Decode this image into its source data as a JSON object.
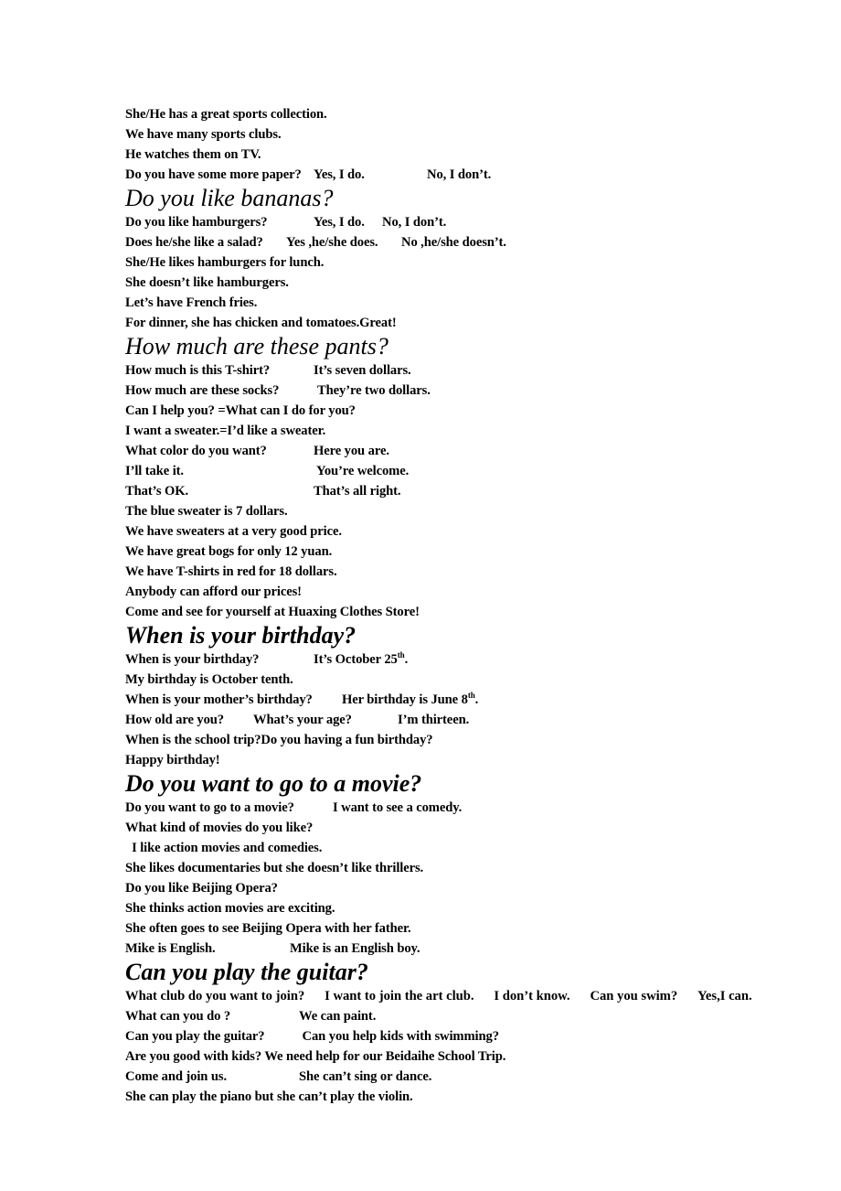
{
  "document": {
    "background_color": "#ffffff",
    "text_color": "#000000",
    "blocks": [
      {
        "type": "line",
        "text": "She/He has a great sports collection."
      },
      {
        "type": "line",
        "text": "We have many sports clubs."
      },
      {
        "type": "line",
        "text": "He watches them on TV."
      },
      {
        "type": "line",
        "text": "Do you have some more paper?",
        "col2": "Yes, I do.",
        "col3": "No, I don’t.",
        "col1_width": 206,
        "col2_width": 124
      },
      {
        "type": "heading",
        "text": "Do you like bananas?",
        "bold": false
      },
      {
        "type": "line",
        "text": "Do you like hamburgers?",
        "col2": "Yes, I do.",
        "col3": "No, I don’t.",
        "col1_width": 206,
        "col2_width": 75
      },
      {
        "type": "line",
        "text": "Does he/she like a salad?",
        "col2": "Yes ,he/she does.",
        "col3": "No ,he/she doesn’t.",
        "col1_width": 176,
        "col2_width": 126
      },
      {
        "type": "line",
        "text": "She/He likes hamburgers for lunch."
      },
      {
        "type": "line",
        "text": "She doesn’t like hamburgers."
      },
      {
        "type": "line",
        "text": "Let’s have French fries."
      },
      {
        "type": "line",
        "text": "For dinner, she has chicken and tomatoes.Great!"
      },
      {
        "type": "heading",
        "text": "How much are these pants?",
        "bold": false
      },
      {
        "type": "line",
        "text": "How much is this T-shirt?",
        "col2": "It’s seven dollars.",
        "col1_width": 206
      },
      {
        "type": "line",
        "text": "How much are these socks?",
        "col2": "They’re two dollars.",
        "col1_width": 210
      },
      {
        "type": "line",
        "text": "Can I help you? =What can I do for you?"
      },
      {
        "type": "line",
        "text": "I want a sweater.=I’d like a sweater."
      },
      {
        "type": "line",
        "text": "What color do you want?",
        "col2": "Here you are.",
        "col1_width": 206
      },
      {
        "type": "line",
        "text": "I’ll take it.",
        "col2": " You’re welcome.",
        "col1_width": 206
      },
      {
        "type": "line",
        "text": "That’s OK.",
        "col2": "That’s all right.",
        "col1_width": 206
      },
      {
        "type": "line",
        "text": "The blue sweater is 7 dollars."
      },
      {
        "type": "line",
        "text": "We have sweaters at a very good price."
      },
      {
        "type": "line",
        "text": "We have great bogs for only 12 yuan."
      },
      {
        "type": "line",
        "text": "We have T-shirts in red for 18 dollars."
      },
      {
        "type": "line",
        "text": "Anybody can afford our prices!"
      },
      {
        "type": "line",
        "text": "Come and see for yourself at Huaxing Clothes Store!"
      },
      {
        "type": "heading",
        "text": "When is your birthday?",
        "bold": true
      },
      {
        "type": "line",
        "text": "When is your birthday?",
        "col2_html": "It’s October 25<sup>th</sup>.",
        "col1_width": 206
      },
      {
        "type": "line",
        "text": "My birthday is October tenth."
      },
      {
        "type": "line",
        "text": "When is your mother’s birthday?",
        "col2_html": "Her birthday is June 8<sup>th</sup>.",
        "col1_width": 237
      },
      {
        "type": "line",
        "text": "How old are you?",
        "col2": "What’s your age?",
        "col3": "I’m thirteen.",
        "col1_width": 140,
        "col2_width": 158
      },
      {
        "type": "line",
        "text": "When is the school trip?",
        "col2": "Do you having a fun birthday?",
        "col1_width": 138
      },
      {
        "type": "line",
        "text": "Happy birthday!"
      },
      {
        "type": "heading",
        "text": "Do you want to go to a movie?",
        "bold": true
      },
      {
        "type": "line",
        "text": "Do you want to go to a movie?",
        "col2": "I want to see a comedy.",
        "col1_width": 227
      },
      {
        "type": "line",
        "text": "What kind of movies do you like?"
      },
      {
        "type": "line",
        "text": "  I like action movies and comedies."
      },
      {
        "type": "line",
        "text": "She likes documentaries but she doesn’t like thrillers."
      },
      {
        "type": "line",
        "text": "Do you like Beijing Opera?"
      },
      {
        "type": "line",
        "text": "She thinks action movies are exciting."
      },
      {
        "type": "line",
        "text": "She often goes to see Beijing Opera with her father."
      },
      {
        "type": "line",
        "text": "Mike is English.",
        "col2": "Mike is an English boy.",
        "col1_width": 180
      },
      {
        "type": "heading",
        "text": "Can you play the guitar?",
        "bold": true
      },
      {
        "type": "justified",
        "segments": [
          "What club do you want to join?",
          "I want to join the art club.",
          "I don’t know.",
          "Can you swim?",
          "Yes,I can."
        ],
        "text": "What club do you want to join?        I want to join the art club.        I don’t know.        Can you swim?        Yes,I can."
      },
      {
        "type": "line",
        "text": "What can you do ?",
        "col2": "We can paint.",
        "col1_width": 190
      },
      {
        "type": "line",
        "text": "Can you play the guitar?",
        "col2": " Can you help kids with swimming?",
        "col1_width": 190
      },
      {
        "type": "line",
        "text": "Are you good with kids? We need help for our Beidaihe School Trip."
      },
      {
        "type": "line",
        "text": "Come and join us.",
        "col2": "She can’t sing or dance.",
        "col1_width": 190
      },
      {
        "type": "line",
        "text": "She can play the piano but she can’t play the violin."
      }
    ]
  }
}
